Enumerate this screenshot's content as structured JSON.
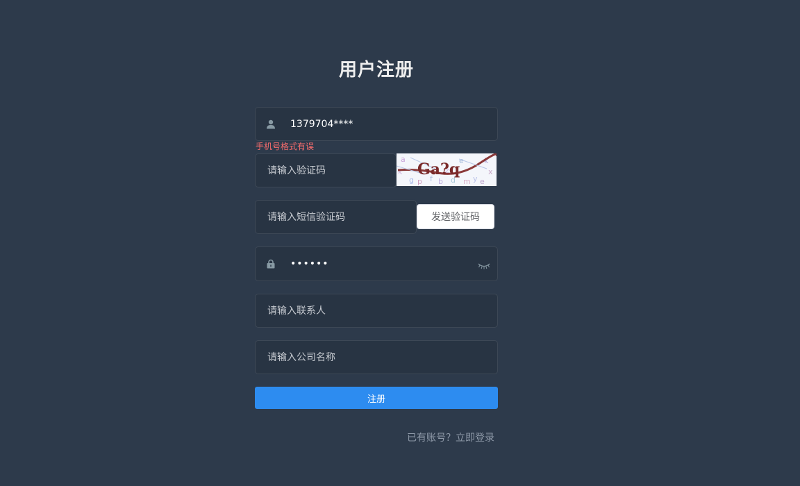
{
  "page": {
    "title": "用户注册"
  },
  "form": {
    "phone": {
      "value": "1379704****",
      "error": "手机号格式有误",
      "icon": "user-icon"
    },
    "captcha": {
      "placeholder": "请输入验证码",
      "image_text": "Ga?q"
    },
    "sms_code": {
      "placeholder": "请输入短信验证码",
      "send_label": "发送验证码"
    },
    "password": {
      "value": "••••••",
      "icon": "lock-icon",
      "toggle_icon": "eye-closed-icon"
    },
    "contact": {
      "placeholder": "请输入联系人"
    },
    "company": {
      "placeholder": "请输入公司名称"
    },
    "submit_label": "注册",
    "login_link": "已有账号？立即登录"
  },
  "colors": {
    "background": "#2d3a4b",
    "input_background": "#283443",
    "primary": "#2d8cf0",
    "error": "#f56c6c"
  }
}
